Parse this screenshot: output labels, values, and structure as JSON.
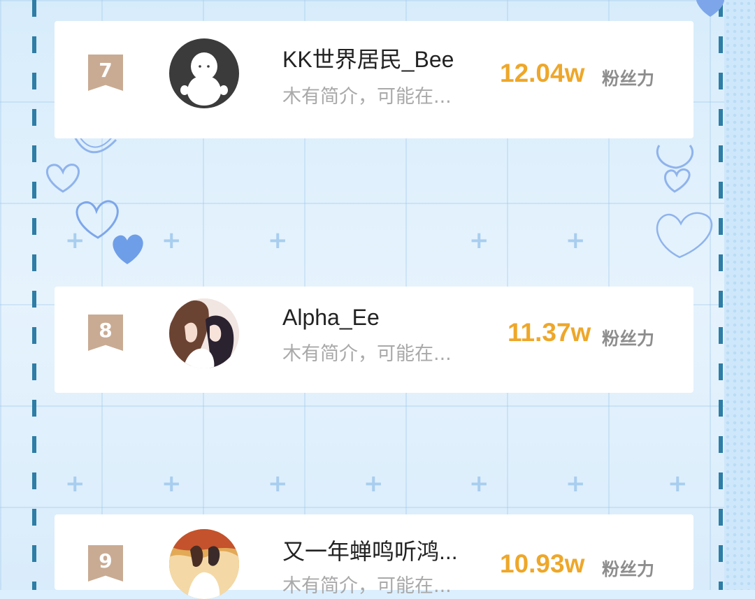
{
  "colors": {
    "accent_score": "#eea72a",
    "rank_badge": "#c9ab93",
    "border_dash": "#2e7ea6",
    "heart": "#6f9ee8"
  },
  "ranking": [
    {
      "rank": "7",
      "name": "KK世界居民_Bee",
      "bio": "木有简介，可能在...",
      "score": "12.04w",
      "unit": "粉丝力",
      "avatar": "ghost-avatar"
    },
    {
      "rank": "8",
      "name": "Alpha_Ee",
      "bio": "木有简介，可能在...",
      "score": "11.37w",
      "unit": "粉丝力",
      "avatar": "illustration-avatar"
    },
    {
      "rank": "9",
      "name": "又一年蝉鸣听鸿...",
      "bio": "木有简介，可能在...",
      "score": "10.93w",
      "unit": "粉丝力",
      "avatar": "illustration-avatar"
    }
  ]
}
